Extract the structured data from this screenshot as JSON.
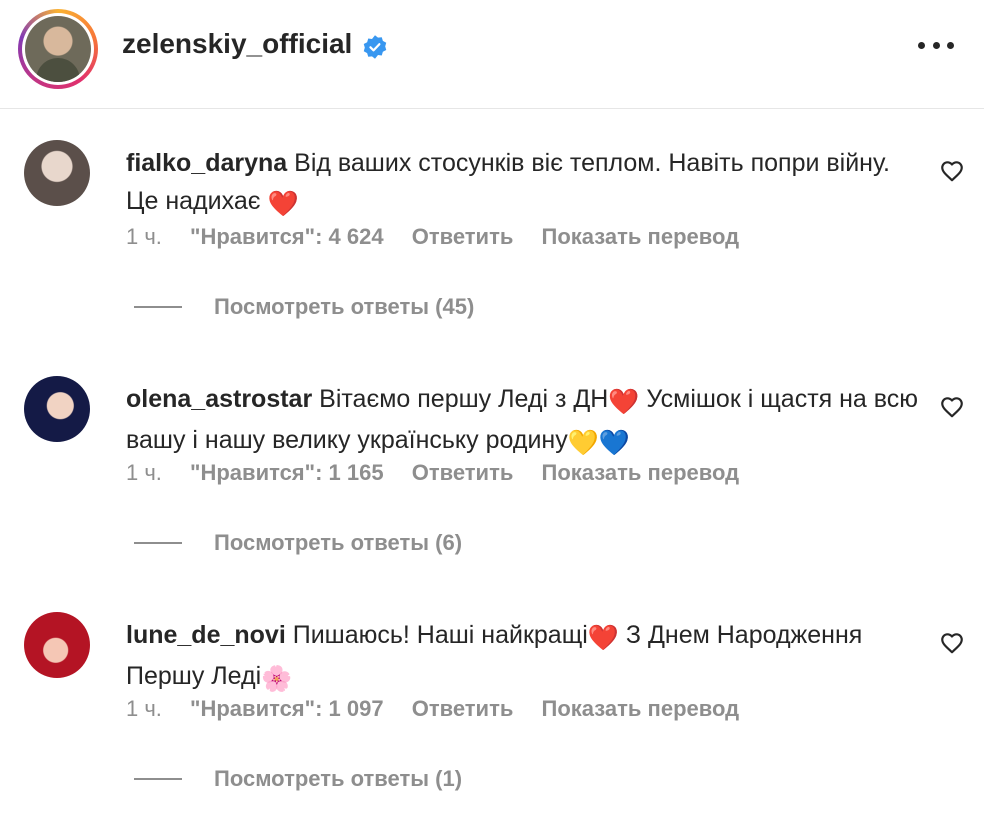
{
  "header": {
    "username": "zelenskiy_official"
  },
  "comments": [
    {
      "user": "fialko_daryna",
      "text": "Від ваших стосунків віє теплом. Навіть попри війну. Це надихає",
      "emoji": "❤️",
      "time": "1 ч.",
      "likes": "\"Нравится\": 4 624",
      "reply": "Ответить",
      "translate": "Показать перевод",
      "view_replies": "Посмотреть ответы (45)"
    },
    {
      "user": "olena_astrostar",
      "text_a": "Вітаємо першу Леді з ДН",
      "emoji_a": "❤️",
      "text_b": " Усмішок і щастя на всю вашу і нашу велику українську родину",
      "emoji_b": "💛💙",
      "time": "1 ч.",
      "likes": "\"Нравится\": 1 165",
      "reply": "Ответить",
      "translate": "Показать перевод",
      "view_replies": "Посмотреть ответы (6)"
    },
    {
      "user": "lune_de_novi",
      "text_a": "Пишаюсь! Наші найкращі",
      "emoji_a": "❤️",
      "text_b": " З Днем Народження Першу Леді",
      "emoji_b": "🌸",
      "time": "1 ч.",
      "likes": "\"Нравится\": 1 097",
      "reply": "Ответить",
      "translate": "Показать перевод",
      "view_replies": "Посмотреть ответы (1)"
    }
  ],
  "colors": {
    "text": "#262626",
    "secondary": "#8e8e8e",
    "verified": "#3897f0"
  },
  "icons": [
    "verified-icon",
    "more-options-icon",
    "heart-icon"
  ]
}
